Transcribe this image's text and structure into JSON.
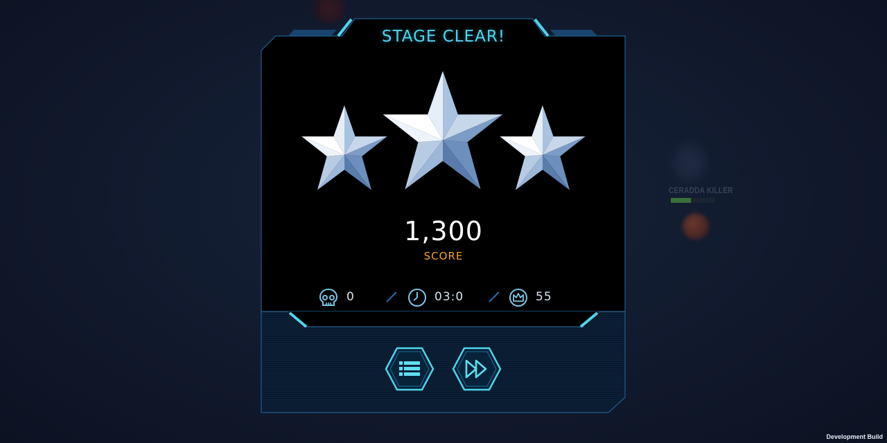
{
  "result": {
    "title": "STAGE CLEAR!",
    "stars_earned": 3,
    "stars_total": 3,
    "score_value": "1,300",
    "score_label": "SCORE"
  },
  "stats": {
    "kills": "0",
    "time": "03:0",
    "crowns": "55"
  },
  "icons": {
    "kills": "skull-icon",
    "time": "clock-icon",
    "crowns": "crown-icon",
    "menu": "list-icon",
    "next": "fast-forward-icon"
  },
  "background": {
    "enemy_name": "CERADDA KILLER",
    "enemy_hp_fraction": 0.45
  },
  "footer": {
    "build_label": "Development Build"
  },
  "colors": {
    "accent_cyan": "#4fd4ea",
    "score_label": "#f2a22c",
    "frame_blue": "#1f5d8e",
    "star_silver": "#9bb6d6"
  }
}
